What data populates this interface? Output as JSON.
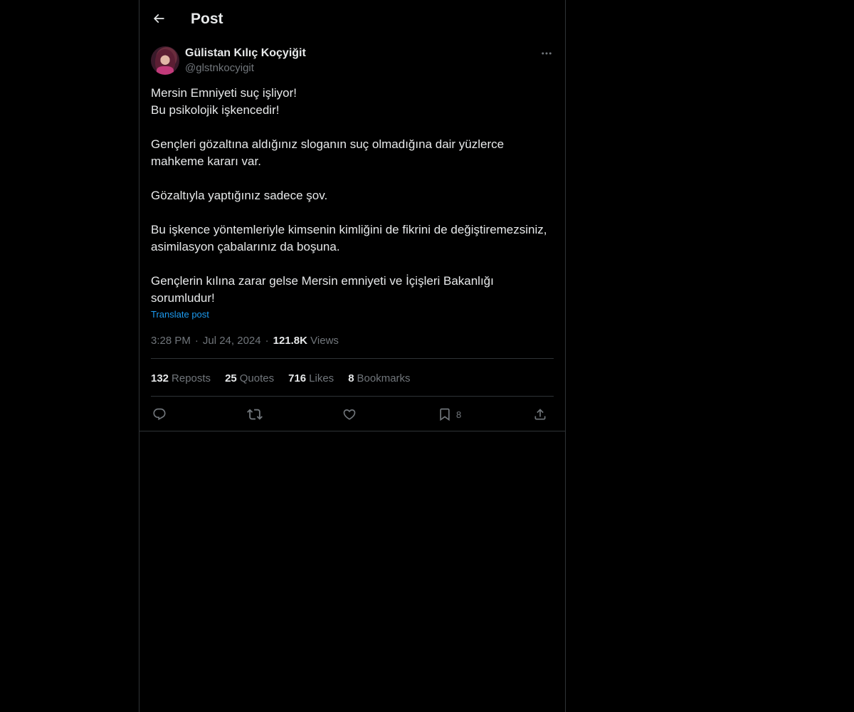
{
  "header": {
    "title": "Post"
  },
  "post": {
    "author": {
      "display_name": "Gülistan Kılıç Koçyiğit",
      "handle": "@glstnkocyigit"
    },
    "paragraphs": [
      "Mersin Emniyeti suç işliyor!\nBu psikolojik işkencedir!",
      "Gençleri gözaltına aldığınız sloganın suç olmadığına  dair yüzlerce mahkeme kararı var.",
      "Gözaltıyla yaptığınız sadece şov.",
      "Bu işkence yöntemleriyle kimsenin kimliğini de fikrini de değiştiremezsiniz, asimilasyon çabalarınız da boşuna.",
      "Gençlerin kılına zarar gelse Mersin emniyeti ve İçişleri Bakanlığı sorumludur!"
    ],
    "translate_label": "Translate post",
    "time": "3:28 PM",
    "date": "Jul 24, 2024",
    "separator": "·",
    "views_count": "121.8K",
    "views_label": "Views"
  },
  "stats": [
    {
      "count": "132",
      "label": "Reposts"
    },
    {
      "count": "25",
      "label": "Quotes"
    },
    {
      "count": "716",
      "label": "Likes"
    },
    {
      "count": "8",
      "label": "Bookmarks"
    }
  ],
  "actions": {
    "reply_icon": "reply-icon",
    "repost_icon": "repost-icon",
    "like_icon": "heart-icon",
    "bookmark_icon": "bookmark-icon",
    "bookmark_count": "8",
    "share_icon": "share-icon"
  },
  "colors": {
    "background": "#000000",
    "text": "#e7e9ea",
    "muted": "#71767b",
    "link": "#1d9bf0",
    "border": "#2f3336"
  }
}
